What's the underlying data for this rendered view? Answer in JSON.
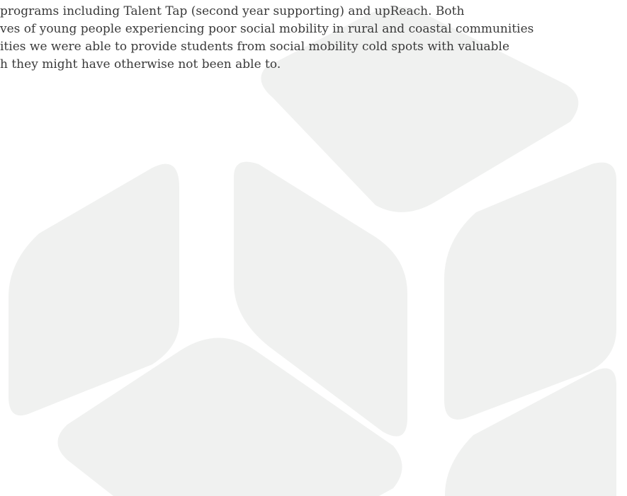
{
  "body_text": {
    "lines": [
      "programs including Talent Tap (second year supporting) and upReach. Both",
      "ves of young people experiencing poor social mobility in rural and coastal communities",
      "ities we were able to provide students from social mobility cold spots with valuable",
      "h they might have otherwise not been able to."
    ]
  },
  "decoration": {
    "shape_color": "#f0f1f0"
  }
}
